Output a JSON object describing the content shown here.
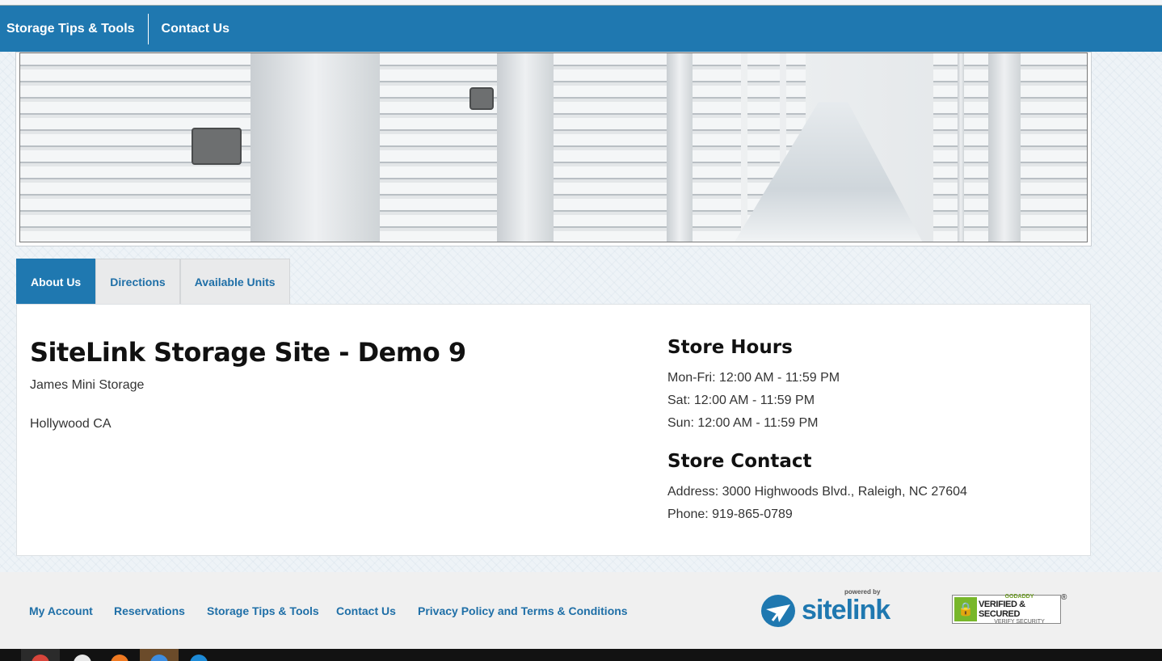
{
  "nav": {
    "items": [
      {
        "label": "Storage Tips & Tools"
      },
      {
        "label": "Contact Us"
      }
    ]
  },
  "hero": {
    "icon": "storage-hallway-photo"
  },
  "tabs": [
    {
      "label": "About Us",
      "active": true
    },
    {
      "label": "Directions",
      "active": false
    },
    {
      "label": "Available Units",
      "active": false
    }
  ],
  "about": {
    "title": "SiteLink Storage Site - Demo 9",
    "company": "James Mini Storage",
    "location": "Hollywood CA"
  },
  "hours": {
    "heading": "Store Hours",
    "lines": [
      "Mon-Fri: 12:00 AM - 11:59 PM",
      "Sat: 12:00 AM - 11:59 PM",
      "Sun: 12:00 AM - 11:59 PM"
    ]
  },
  "contact": {
    "heading": "Store Contact",
    "address": "Address: 3000 Highwoods Blvd., Raleigh, NC 27604",
    "phone": "Phone: 919-865-0789"
  },
  "footer": {
    "links": [
      {
        "label": "My Account"
      },
      {
        "label": "Reservations"
      },
      {
        "label": "Storage Tips & Tools"
      },
      {
        "label": "Contact Us"
      },
      {
        "label": "Privacy Policy and Terms & Conditions"
      }
    ],
    "powered_by": "powered by",
    "sitelink_logo": "sitelink",
    "godaddy": {
      "top": "GODADDY",
      "main": "VERIFIED & SECURED",
      "bottom": "VERIFY SECURITY",
      "reg": "®"
    }
  },
  "colors": {
    "brand": "#1f78b0",
    "godaddy_green": "#78b72a"
  }
}
